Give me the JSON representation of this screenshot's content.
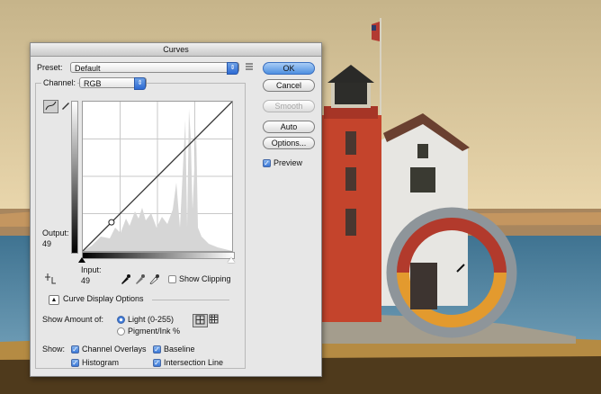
{
  "dialog": {
    "title": "Curves",
    "preset_label": "Preset:",
    "preset_value": "Default",
    "channel_label": "Channel:",
    "channel_value": "RGB",
    "output_label": "Output:",
    "output_value": "49",
    "input_label": "Input:",
    "input_value": "49",
    "show_clipping_label": "Show Clipping",
    "curve_display_options_label": "Curve Display Options",
    "show_amount_label": "Show Amount of:",
    "light_label": "Light  (0-255)",
    "pigment_label": "Pigment/Ink %",
    "show_label": "Show:",
    "channel_overlays_label": "Channel Overlays",
    "baseline_label": "Baseline",
    "histogram_label": "Histogram",
    "intersection_line_label": "Intersection Line",
    "preview_label": "Preview"
  },
  "buttons": {
    "ok": "OK",
    "cancel": "Cancel",
    "smooth": "Smooth",
    "auto": "Auto",
    "options": "Options..."
  },
  "checks": {
    "show_clipping": false,
    "channel_overlays": true,
    "baseline": true,
    "histogram": true,
    "intersection_line": true,
    "preview": true
  },
  "radios": {
    "light": true,
    "pigment": false
  },
  "curve_point": {
    "input": 49,
    "output": 49
  },
  "colors": {
    "accent": "#3a78d8",
    "lighthouse_red": "#c4442c",
    "ring_red": "#b23a2c",
    "ring_orange": "#e39a2e",
    "ring_gray": "#8e959a"
  },
  "icons": [
    "curve-point-tool-icon",
    "pencil-tool-icon",
    "presets-menu-icon",
    "targeted-adjustment-icon",
    "black-eyedropper-icon",
    "gray-eyedropper-icon",
    "white-eyedropper-icon",
    "disclosure-triangle-icon",
    "grid-simple-icon",
    "grid-detailed-icon"
  ]
}
